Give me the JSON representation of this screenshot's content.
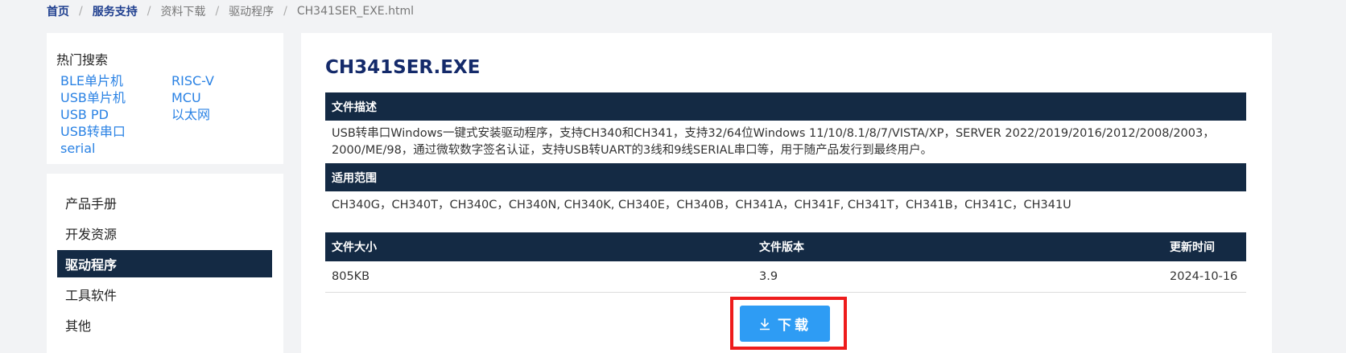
{
  "breadcrumb": {
    "home": "首页",
    "support": "服务支持",
    "downloads": "资料下载",
    "drivers": "驱动程序",
    "current": "CH341SER_EXE.html",
    "separator": "/"
  },
  "hot_search": {
    "title": "热门搜索",
    "col1": [
      "BLE单片机",
      "USB单片机",
      "USB PD",
      "USB转串口",
      "serial"
    ],
    "col2": [
      "RISC-V",
      "MCU",
      "以太网"
    ]
  },
  "side_menu": {
    "items": [
      "产品手册",
      "开发资源",
      "驱动程序",
      "工具软件",
      "其他"
    ],
    "active": "驱动程序"
  },
  "file": {
    "title": "CH341SER.EXE",
    "desc_label": "文件描述",
    "desc_line1": "USB转串口Windows一键式安装驱动程序，支持CH340和CH341，支持32/64位Windows 11/10/8.1/8/7/VISTA/XP，SERVER 2022/2019/2016/2012/2008/2003，",
    "desc_line2": "2000/ME/98，通过微软数字签名认证，支持USB转UART的3线和9线SERIAL串口等，用于随产品发行到最终用户。",
    "scope_label": "适用范围",
    "scope_text": "CH340G，CH340T，CH340C，CH340N, CH340K, CH340E，CH340B，CH341A，CH341F, CH341T，CH341B，CH341C，CH341U",
    "size_label": "文件大小",
    "version_label": "文件版本",
    "updated_label": "更新时间",
    "size": "805KB",
    "version": "3.9",
    "updated": "2024-10-16"
  },
  "download": {
    "label": "下载",
    "icon": "download-icon"
  },
  "colors": {
    "navy": "#142a44",
    "link": "#2a82e4",
    "button": "#2e9cf4",
    "highlight_frame": "#ee1c1c"
  }
}
